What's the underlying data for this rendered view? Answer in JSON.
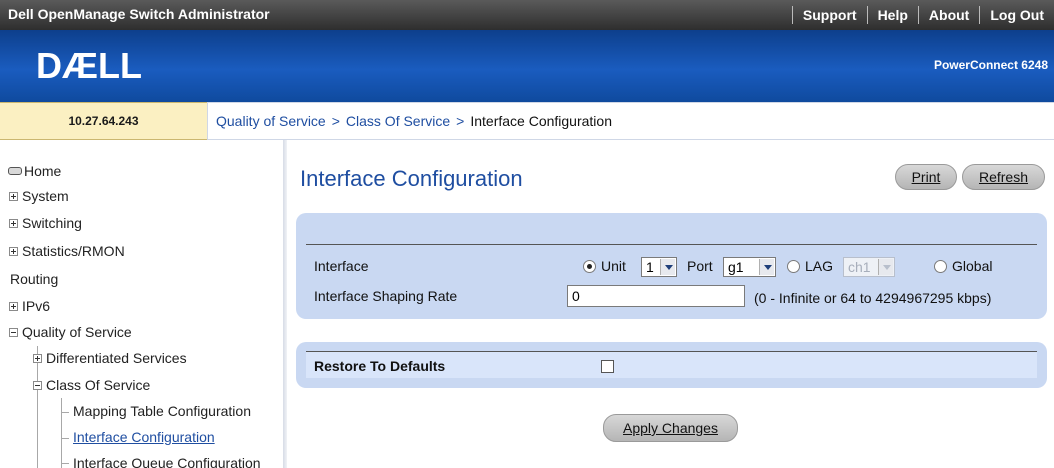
{
  "app": {
    "title": "Dell OpenManage Switch Administrator",
    "top_links": [
      "Support",
      "Help",
      "About",
      "Log Out"
    ]
  },
  "banner": {
    "logo_text": "DÆLL",
    "product": "PowerConnect 6248"
  },
  "ip_address": "10.27.64.243",
  "breadcrumb": {
    "links": [
      "Quality of Service",
      "Class Of Service"
    ],
    "separator": ">",
    "current": "Interface Configuration"
  },
  "nav": {
    "home": "Home",
    "system": "System",
    "switching": "Switching",
    "statistics": "Statistics/RMON",
    "routing": "Routing",
    "ipv6": "IPv6",
    "qos": "Quality of Service",
    "diffserv": "Differentiated Services",
    "cos": "Class Of Service",
    "mapping": "Mapping Table Configuration",
    "interface_config": "Interface Configuration",
    "queue_config": "Interface Queue Configuration"
  },
  "main": {
    "title": "Interface Configuration",
    "print_label": "Print",
    "refresh_label": "Refresh",
    "interface_label": "Interface",
    "unit_label": "Unit",
    "unit_value": "1",
    "port_label": "Port",
    "port_value": "g1",
    "lag_label": "LAG",
    "lag_value": "ch1",
    "global_label": "Global",
    "selected_interface_type": "Unit",
    "shaping_label": "Interface Shaping Rate",
    "shaping_value": "0",
    "shaping_hint": "(0 - Infinite or 64 to 4294967295 kbps)",
    "restore_label": "Restore To Defaults",
    "restore_checked": false,
    "apply_label": "Apply Changes"
  }
}
